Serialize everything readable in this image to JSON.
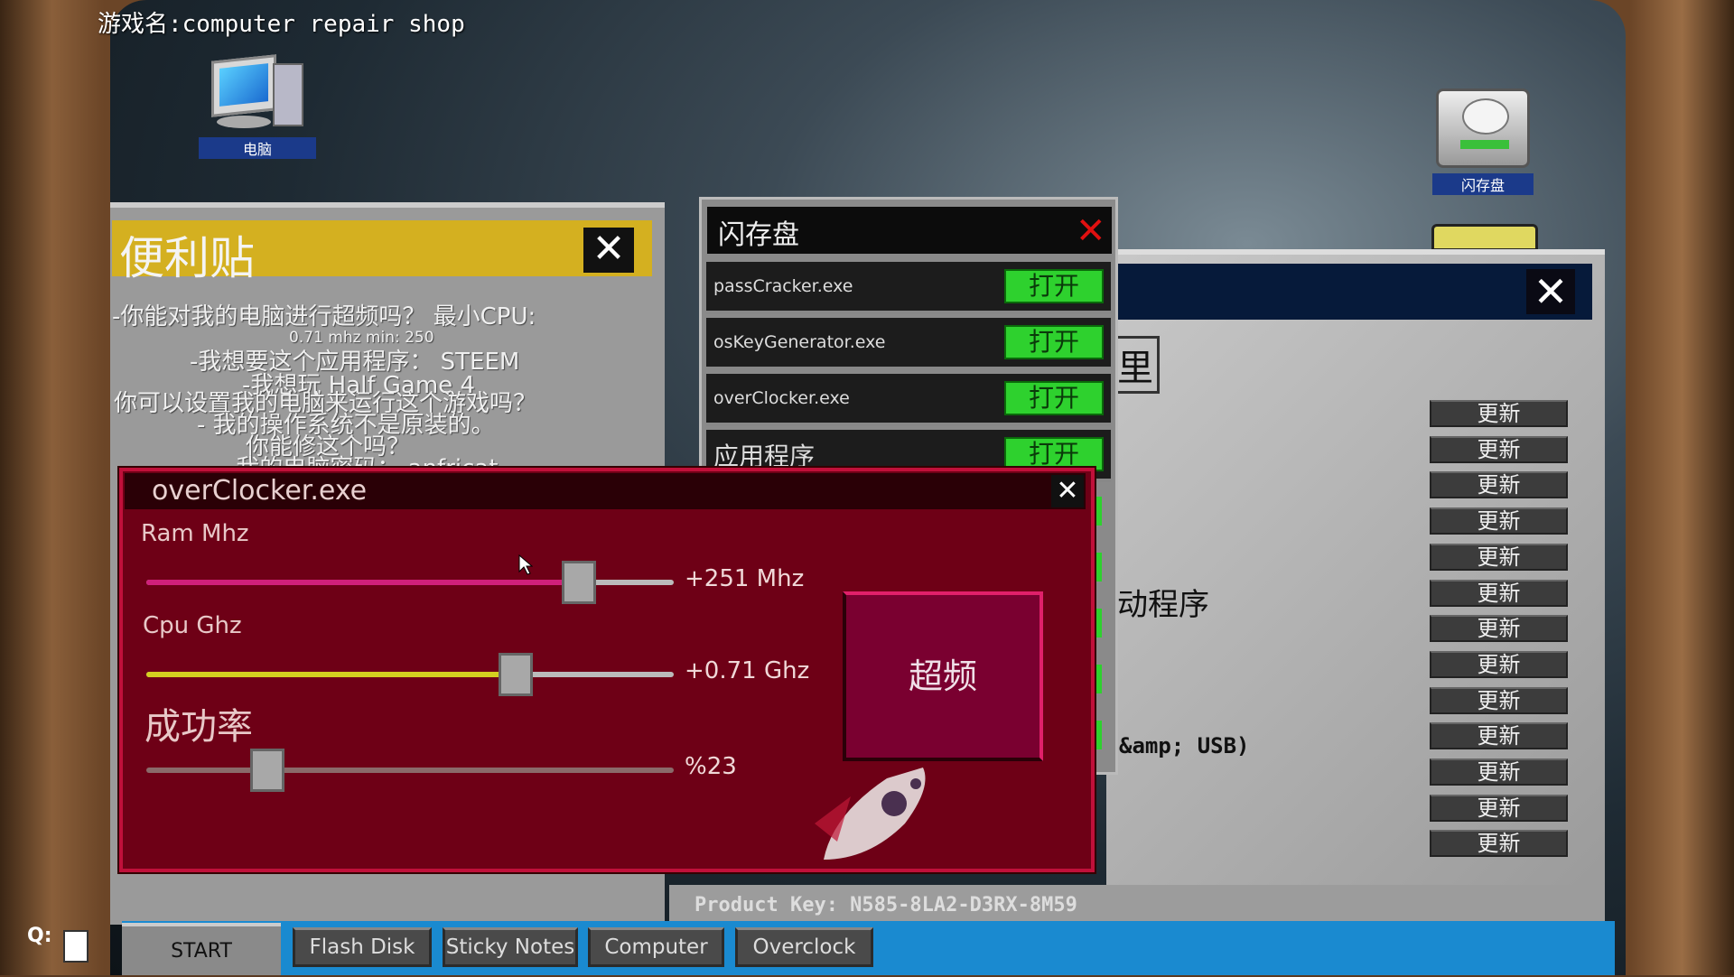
{
  "title": "游戏名:computer repair shop",
  "desktop": {
    "computer_label": "电脑",
    "flashdisk_label": "闪存盘"
  },
  "sticky": {
    "title": "便利贴",
    "lines": [
      "-你能对我的电脑进行超频吗？ 最小CPU:",
      "0.71 mhz min: 250",
      "-我想要这个应用程序： STEEM",
      "-我想玩 Half Game 4",
      "你可以设置我的电脑来运行这个游戏吗？",
      "- 我的操作系统不是原装的。",
      "你能修这个吗？",
      "-我的电脑密码： anfricat"
    ]
  },
  "flashdisk": {
    "title": "闪存盘",
    "items": [
      {
        "name": "passCracker.exe",
        "button": "打开"
      },
      {
        "name": "osKeyGenerator.exe",
        "button": "打开"
      },
      {
        "name": "overClocker.exe",
        "button": "打开"
      },
      {
        "name": "应用程序",
        "button": "打开"
      }
    ]
  },
  "driver_window": {
    "fragment1": "里",
    "fragment2": "动程序",
    "fragment3": "&amp; USB)",
    "update_buttons": [
      "更新",
      "更新",
      "更新",
      "更新",
      "更新",
      "更新",
      "更新",
      "更新",
      "更新",
      "更新",
      "更新",
      "更新",
      "更新"
    ],
    "product_key": "Product Key: N585-8LA2-D3RX-8M59"
  },
  "overclocker": {
    "title": "overClocker.exe",
    "ram_label": "Ram Mhz",
    "ram_value": "+251 Mhz",
    "ram_level": 0.82,
    "cpu_label": "Cpu Ghz",
    "cpu_value": "+0.71 Ghz",
    "cpu_level": 0.7,
    "success_label": "成功率",
    "success_value": "%23",
    "success_level": 0.23,
    "overclock_button": "超频",
    "colors": {
      "ram_fill": "#d0207a",
      "cpu_fill": "#d4d020",
      "window": "#6e0016"
    }
  },
  "taskbar": {
    "start": "START",
    "items": [
      "Flash Disk",
      "Sticky Notes",
      "Computer",
      "Overclock"
    ],
    "quit_hint": "Q:"
  }
}
